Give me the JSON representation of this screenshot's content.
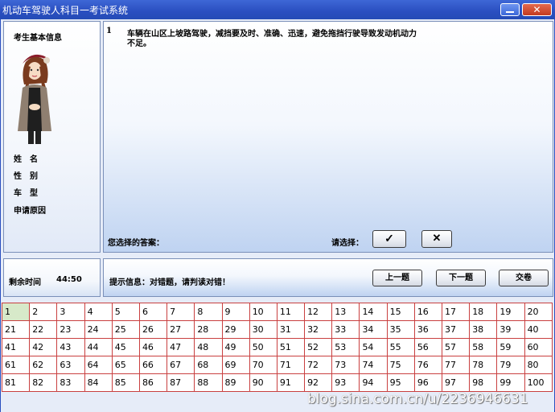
{
  "window": {
    "title": "机动车驾驶人科目一考试系统",
    "close_glyph": "✕"
  },
  "examinee": {
    "header": "考生基本信息",
    "fields": [
      "姓　名",
      "性　别",
      "车　型",
      "申请原因"
    ]
  },
  "question": {
    "number": "1",
    "line1": "车辆在山区上坡路驾驶，减挡要及时、准确、迅速，避免拖挡行驶导致发动机动力",
    "line2": "不足。",
    "selected_answer_label": "您选择的答案：",
    "choose_label": "请选择：",
    "option_true": "✓",
    "option_false": "✕"
  },
  "timer": {
    "label": "剩余时间",
    "value": "44:50"
  },
  "hint": {
    "text": "提示信息：对错题，请判读对错！"
  },
  "buttons": {
    "prev": "上一题",
    "next": "下一题",
    "submit": "交卷"
  },
  "question_grid": {
    "current": 1,
    "numbers": [
      [
        "1",
        "2",
        "3",
        "4",
        "5",
        "6",
        "7",
        "8",
        "9",
        "10",
        "11",
        "12",
        "13",
        "14",
        "15",
        "16",
        "17",
        "18",
        "19",
        "20"
      ],
      [
        "21",
        "22",
        "23",
        "24",
        "25",
        "26",
        "27",
        "28",
        "29",
        "30",
        "31",
        "32",
        "33",
        "34",
        "35",
        "36",
        "37",
        "38",
        "39",
        "40"
      ],
      [
        "41",
        "42",
        "43",
        "44",
        "45",
        "46",
        "47",
        "48",
        "49",
        "50",
        "51",
        "52",
        "53",
        "54",
        "55",
        "56",
        "57",
        "58",
        "59",
        "60"
      ],
      [
        "61",
        "62",
        "63",
        "64",
        "65",
        "66",
        "67",
        "68",
        "69",
        "70",
        "71",
        "72",
        "73",
        "74",
        "75",
        "76",
        "77",
        "78",
        "79",
        "80"
      ],
      [
        "81",
        "82",
        "83",
        "84",
        "85",
        "86",
        "87",
        "88",
        "89",
        "90",
        "91",
        "92",
        "93",
        "94",
        "95",
        "96",
        "97",
        "98",
        "99",
        "100"
      ]
    ]
  },
  "watermark": "blog.sina.com.cn/u/2236946631",
  "colors": {
    "titlebar": "#2a4fc0",
    "grid_border": "#c94040",
    "current_cell": "#d7e9c9"
  }
}
